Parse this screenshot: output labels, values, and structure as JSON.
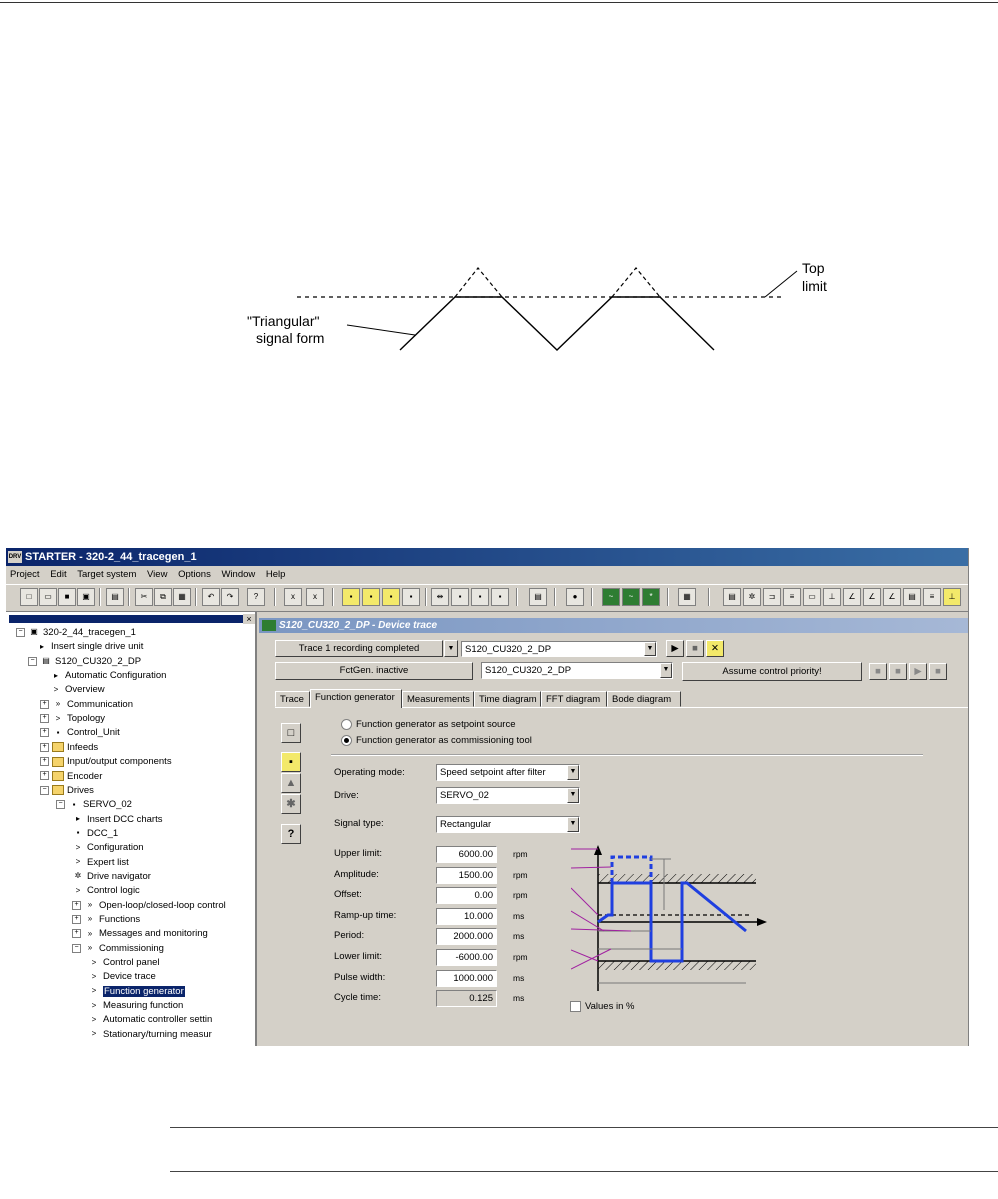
{
  "figure": {
    "label_left_line1": "\"Triangular\"",
    "label_left_line2": "signal form",
    "label_right_line1": "Top",
    "label_right_line2": "limit"
  },
  "window": {
    "title": "STARTER - 320-2_44_tracegen_1",
    "title_icon": "DRV",
    "menu": [
      "Project",
      "Edit",
      "Target system",
      "View",
      "Options",
      "Window",
      "Help"
    ]
  },
  "tree": {
    "items": [
      {
        "label": "320-2_44_tracegen_1",
        "icon": "project-icon"
      },
      {
        "label": "Insert single drive unit",
        "icon": "insert-icon"
      },
      {
        "label": "S120_CU320_2_DP",
        "icon": "drive-unit-icon"
      },
      {
        "label": "Automatic Configuration",
        "icon": "insert-icon"
      },
      {
        "label": "Overview",
        "icon": "arrow-icon"
      },
      {
        "label": "Communication",
        "icon": "double-arrow-icon"
      },
      {
        "label": "Topology",
        "icon": "arrow-icon"
      },
      {
        "label": "Control_Unit",
        "icon": "control-unit-icon"
      },
      {
        "label": "Infeeds",
        "icon": "folder-icon"
      },
      {
        "label": "Input/output components",
        "icon": "folder-icon"
      },
      {
        "label": "Encoder",
        "icon": "folder-icon"
      },
      {
        "label": "Drives",
        "icon": "folder-icon"
      },
      {
        "label": "SERVO_02",
        "icon": "servo-icon"
      },
      {
        "label": "Insert DCC charts",
        "icon": "insert-icon"
      },
      {
        "label": "DCC_1",
        "icon": "dcc-icon"
      },
      {
        "label": "Configuration",
        "icon": "arrow-icon"
      },
      {
        "label": "Expert list",
        "icon": "arrow-icon"
      },
      {
        "label": "Drive navigator",
        "icon": "navigator-icon"
      },
      {
        "label": "Control logic",
        "icon": "arrow-icon"
      },
      {
        "label": "Open-loop/closed-loop control",
        "icon": "double-arrow-icon"
      },
      {
        "label": "Functions",
        "icon": "double-arrow-icon"
      },
      {
        "label": "Messages and monitoring",
        "icon": "double-arrow-icon"
      },
      {
        "label": "Commissioning",
        "icon": "double-arrow-icon"
      },
      {
        "label": "Control panel",
        "icon": "arrow-icon"
      },
      {
        "label": "Device trace",
        "icon": "arrow-icon"
      },
      {
        "label": "Function generator",
        "icon": "arrow-icon"
      },
      {
        "label": "Measuring function",
        "icon": "arrow-icon"
      },
      {
        "label": "Automatic controller settin",
        "icon": "arrow-icon"
      },
      {
        "label": "Stationary/turning measur",
        "icon": "arrow-icon"
      }
    ]
  },
  "device_trace": {
    "title": "S120_CU320_2_DP - Device trace",
    "trace_status": "Trace 1 recording completed",
    "trace_device": "S120_CU320_2_DP",
    "fctgen_status": "FctGen. inactive",
    "fctgen_device": "S120_CU320_2_DP",
    "assume_priority": "Assume control priority!",
    "tabs": [
      "Trace",
      "Function generator",
      "Measurements",
      "Time diagram",
      "FFT diagram",
      "Bode diagram"
    ],
    "active_tab": "Function generator",
    "radio_setpoint": "Function generator as setpoint source",
    "radio_commissioning": "Function generator as commissioning tool",
    "operating_mode_label": "Operating mode:",
    "operating_mode_value": "Speed setpoint after filter",
    "drive_label": "Drive:",
    "drive_value": "SERVO_02",
    "signal_type_label": "Signal type:",
    "signal_type_value": "Rectangular",
    "params": [
      {
        "label": "Upper limit:",
        "value": "6000.00",
        "unit": "rpm"
      },
      {
        "label": "Amplitude:",
        "value": "1500.00",
        "unit": "rpm"
      },
      {
        "label": "Offset:",
        "value": "0.00",
        "unit": "rpm"
      },
      {
        "label": "Ramp-up time:",
        "value": "10.000",
        "unit": "ms"
      },
      {
        "label": "Period:",
        "value": "2000.000",
        "unit": "ms"
      },
      {
        "label": "Lower limit:",
        "value": "-6000.00",
        "unit": "rpm"
      },
      {
        "label": "Pulse width:",
        "value": "1000.000",
        "unit": "ms"
      },
      {
        "label": "Cycle time:",
        "value": "0.125",
        "unit": "ms"
      }
    ],
    "values_in_percent": "Values in %",
    "help_label": "?",
    "colors": {
      "signal": "#1f3fe0",
      "accent": "#0a246a"
    }
  }
}
